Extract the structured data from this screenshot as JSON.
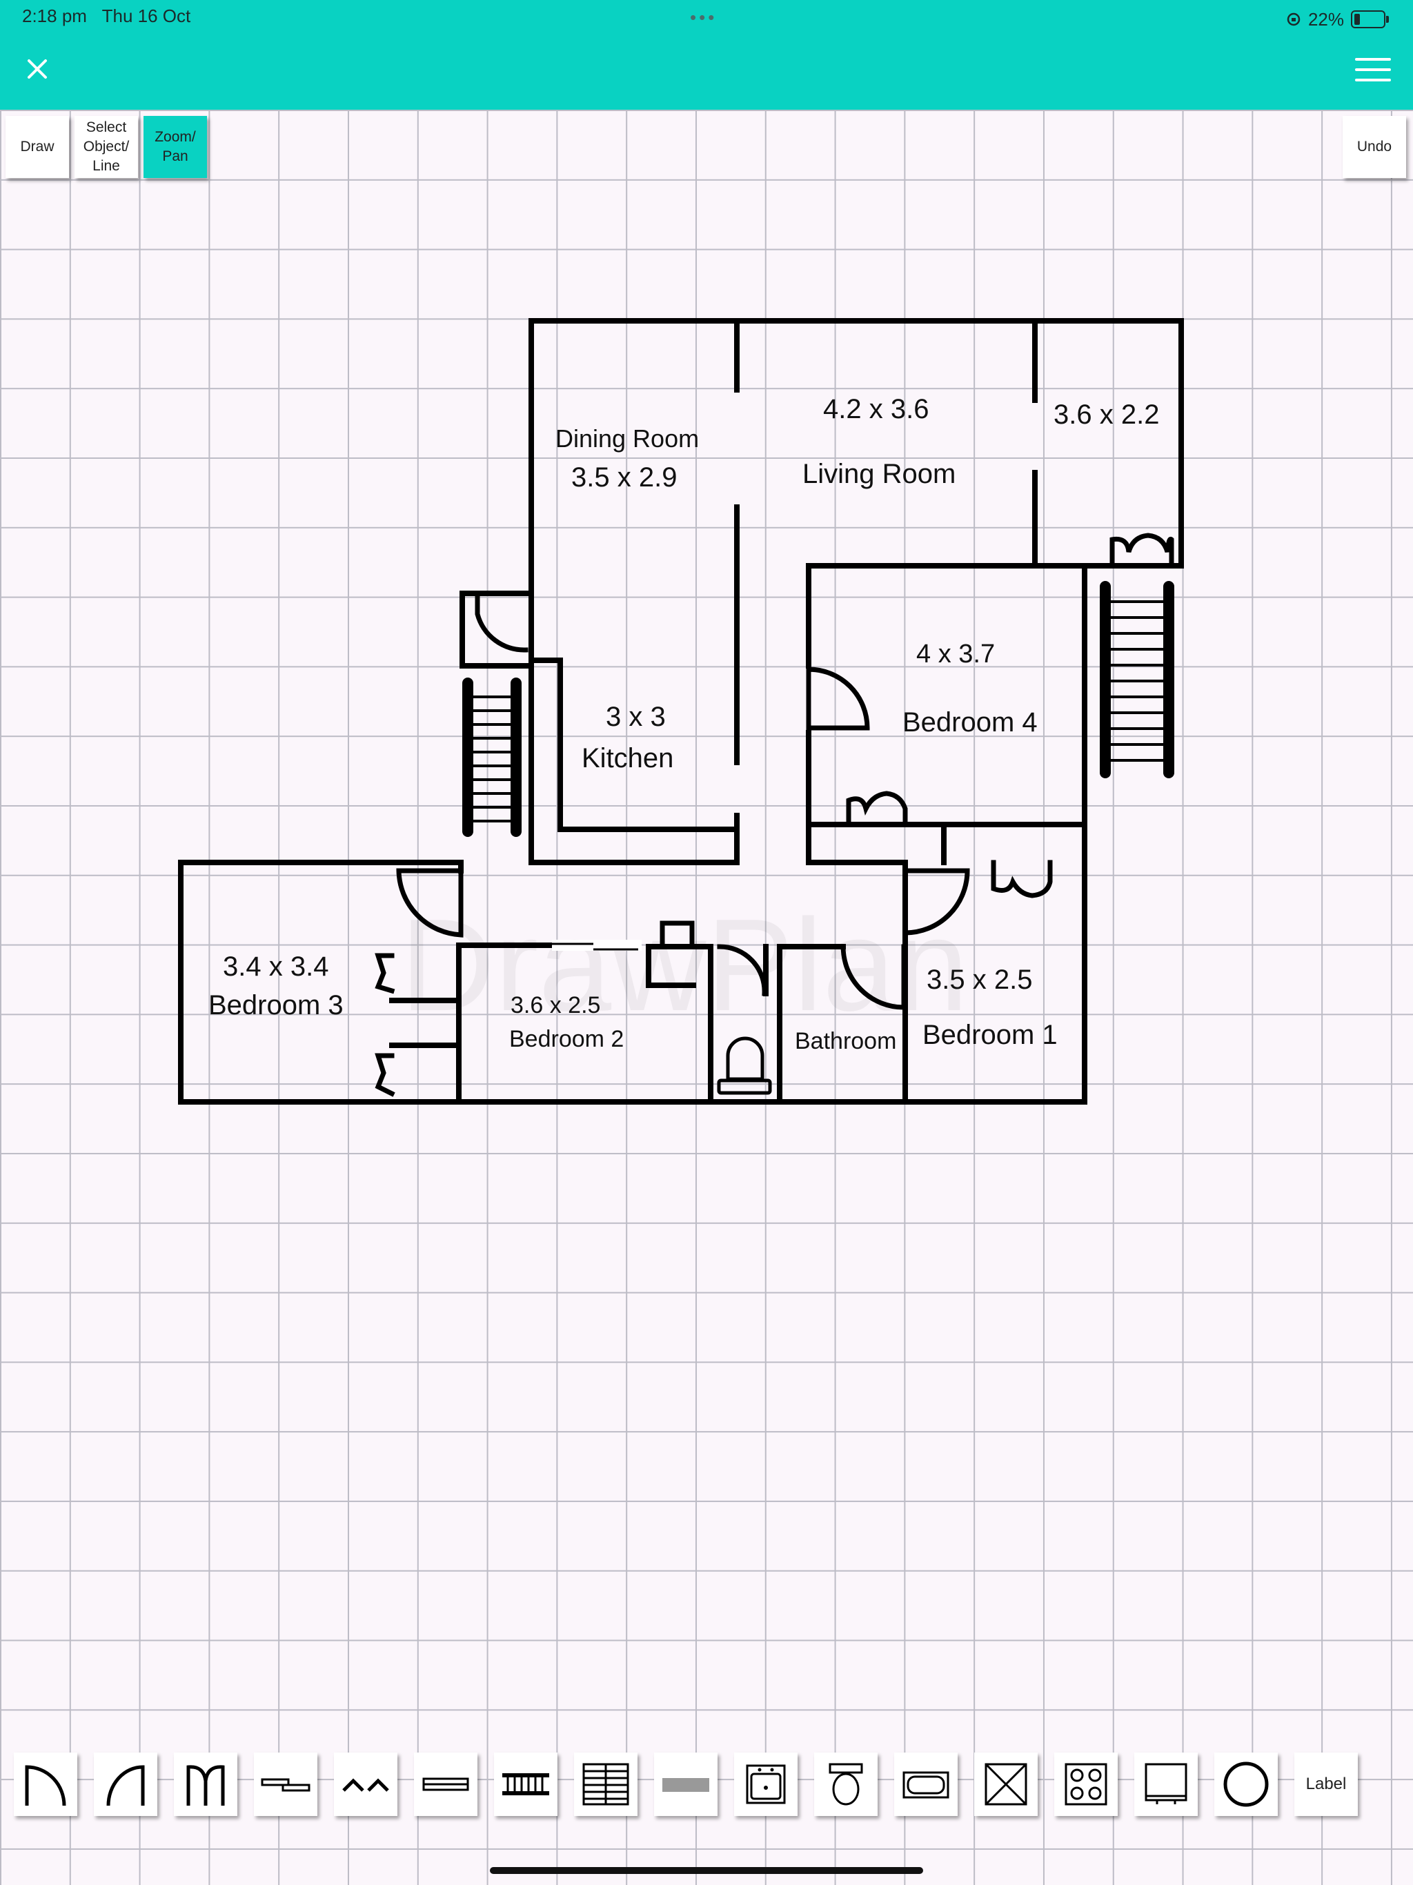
{
  "status_bar": {
    "time": "2:18 pm",
    "date": "Thu 16 Oct",
    "battery": "22%"
  },
  "app": {
    "accent_color": "#09d2c2",
    "close_icon": "close-icon",
    "menu_icon": "hamburger-menu-icon"
  },
  "toolbar": {
    "draw": "Draw",
    "select": "Select Object/ Line",
    "zoom": "Zoom/ Pan",
    "undo": "Undo",
    "active": "zoom"
  },
  "watermark": "DrawPlan",
  "rooms": {
    "dining": {
      "name": "Dining Room",
      "size": "3.5 x 2.9"
    },
    "living": {
      "name": "Living Room",
      "size": "4.2 x 3.6"
    },
    "extra": {
      "size": "3.6 x 2.2"
    },
    "kitchen": {
      "name": "Kitchen",
      "size": "3 x 3"
    },
    "bedroom4": {
      "name": "Bedroom 4",
      "size": "4 x 3.7"
    },
    "bedroom3": {
      "name": "Bedroom 3",
      "size": "3.4 x 3.4"
    },
    "bedroom2": {
      "name": "Bedroom 2",
      "size": "3.6 x 2.5"
    },
    "bathroom": {
      "name": "Bathroom"
    },
    "bedroom1": {
      "name": "Bedroom 1",
      "size": "3.5 x 2.5"
    }
  },
  "palette": {
    "items": [
      "door-icon",
      "half-door-icon",
      "double-door-icon",
      "sliding-door-icon",
      "bifold-door-icon",
      "window-icon",
      "stairs-icon",
      "staircase-icon",
      "wall-block-icon",
      "sink-icon",
      "toilet-icon",
      "bath-icon",
      "shower-icon",
      "stove-icon",
      "fridge-icon",
      "circle-icon"
    ],
    "label": "Label"
  }
}
